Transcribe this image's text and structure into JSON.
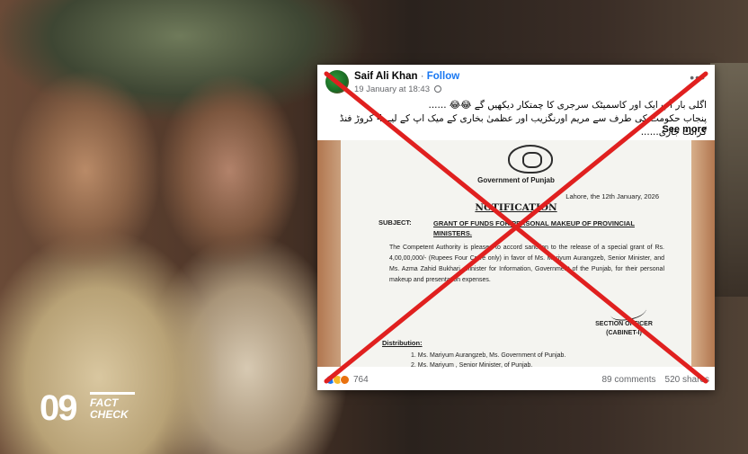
{
  "post": {
    "author": "Saif Ali Khan",
    "separator": "·",
    "follow": "Follow",
    "timestamp": "19 January at 18:43",
    "caption_line1": "اگلی بار آپ ایک اور کاسمیٹک سرجری کا چمتکار دیکھیں گے 😂😂 ......",
    "caption_line2": "پنجاب حکومت کی طرف سے مریم اورنگزیب اور عظمیٰ بخاری کے میک اپ کے لیے 4 کروڑ فنڈ گرانٹ جاری......",
    "see_more": "See more",
    "reaction_count": "764",
    "comments": "89 comments",
    "shares": "520 shares"
  },
  "document": {
    "government": "Government of Punjab",
    "date": "Lahore, the 12th January, 2026",
    "title": "NOTIFICATION",
    "subject_label": "SUBJECT:",
    "subject": "GRANT OF FUNDS FOR PERSONAL MAKEUP OF PROVINCIAL MINISTERS.",
    "body": "The Competent Authority is pleased to accord sanction to the release of a special grant of Rs. 4,00,00,000/- (Rupees Four Crore only) in favor of Ms. Mariyum Aurangzeb, Senior Minister, and Ms. Azma Zahid Bukhari, Minister for Information, Government of the Punjab, for their personal makeup and presentation expenses.",
    "officer_line1": "SECTION OFFICER",
    "officer_line2": "(CABINET-I)",
    "distribution_label": "Distribution:",
    "distribution": [
      "1.   Ms. Mariyum Aurangzeb, Ms. Government of Punjab.",
      "2.   Ms. Mariyum , Senior Minister, of Punjab."
    ]
  },
  "logo": {
    "number": "09",
    "line1": "FACT",
    "line2": "CHECK"
  },
  "colors": {
    "facebook_blue": "#1877f2",
    "cross_red": "#e0201f"
  },
  "icons": {
    "more": "more-icon",
    "globe": "globe-icon",
    "check": "check-icon"
  }
}
